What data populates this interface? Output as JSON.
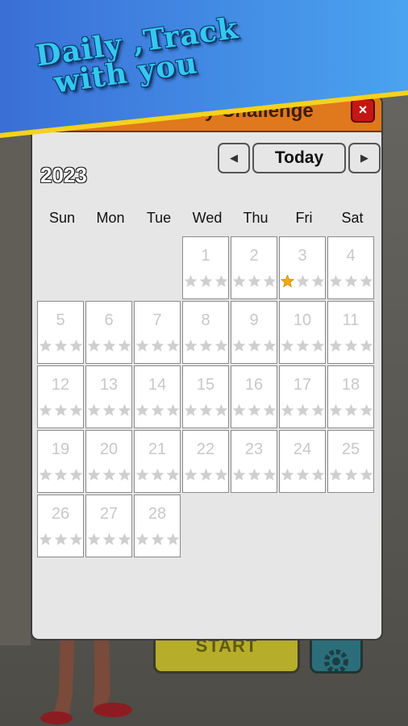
{
  "banner": {
    "line1": "Daily ,Track",
    "line2": "with you"
  },
  "background": {
    "start_label": "START"
  },
  "modal": {
    "title": "Daily Challenge",
    "close_label": "×",
    "year": "2023",
    "nav": {
      "prev_icon": "◀",
      "today_label": "Today",
      "next_icon": "▶"
    },
    "weekdays": [
      "Sun",
      "Mon",
      "Tue",
      "Wed",
      "Thu",
      "Fri",
      "Sat"
    ],
    "month": {
      "first_weekday": 3,
      "days": [
        {
          "day": "1",
          "stars": 0
        },
        {
          "day": "2",
          "stars": 0
        },
        {
          "day": "3",
          "stars": 1
        },
        {
          "day": "4",
          "stars": 0
        },
        {
          "day": "5",
          "stars": 0
        },
        {
          "day": "6",
          "stars": 0
        },
        {
          "day": "7",
          "stars": 0
        },
        {
          "day": "8",
          "stars": 0
        },
        {
          "day": "9",
          "stars": 0
        },
        {
          "day": "10",
          "stars": 0
        },
        {
          "day": "11",
          "stars": 0
        },
        {
          "day": "12",
          "stars": 0
        },
        {
          "day": "13",
          "stars": 0
        },
        {
          "day": "14",
          "stars": 0
        },
        {
          "day": "15",
          "stars": 0
        },
        {
          "day": "16",
          "stars": 0
        },
        {
          "day": "17",
          "stars": 0
        },
        {
          "day": "18",
          "stars": 0
        },
        {
          "day": "19",
          "stars": 0
        },
        {
          "day": "20",
          "stars": 0
        },
        {
          "day": "21",
          "stars": 0
        },
        {
          "day": "22",
          "stars": 0
        },
        {
          "day": "23",
          "stars": 0
        },
        {
          "day": "24",
          "stars": 0
        },
        {
          "day": "25",
          "stars": 0
        },
        {
          "day": "26",
          "stars": 0
        },
        {
          "day": "27",
          "stars": 0
        },
        {
          "day": "28",
          "stars": 0
        }
      ],
      "max_stars": 3
    }
  },
  "colors": {
    "star_on": "#f2a810",
    "star_off": "#cfcfcf",
    "header": "#e0781d",
    "close": "#c51616"
  }
}
